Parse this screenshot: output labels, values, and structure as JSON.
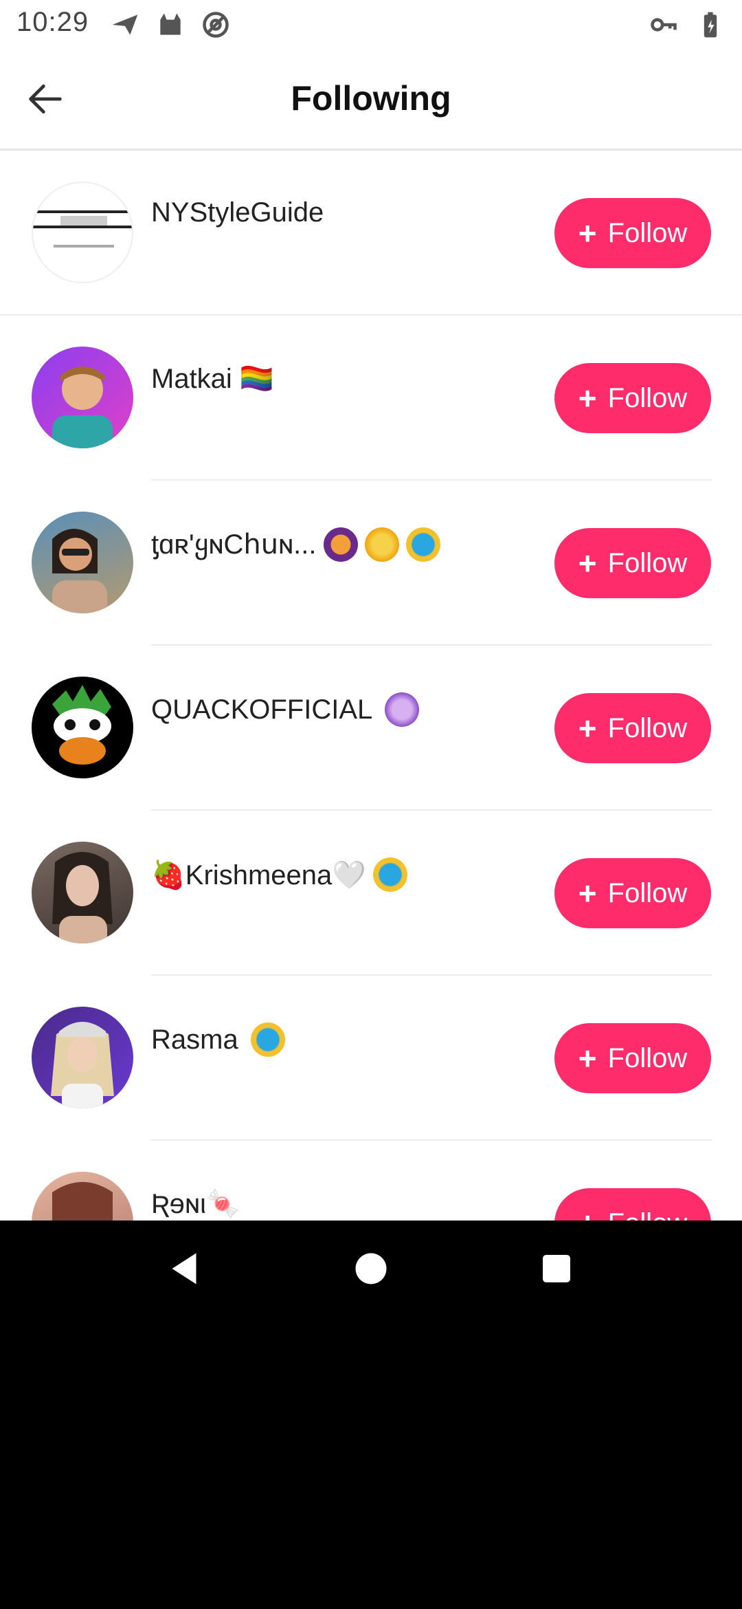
{
  "status_bar": {
    "time": "10:29",
    "left_icons": [
      "send-icon",
      "cat-icon",
      "at-sign-icon"
    ],
    "right_icons": [
      "key-icon",
      "battery-icon"
    ]
  },
  "header": {
    "title": "Following",
    "back_icon": "arrow-left-icon"
  },
  "follow_label": "Follow",
  "users": [
    {
      "name": "NYStyleGuide",
      "badges": []
    },
    {
      "name": "Matkai 🏳️‍🌈",
      "badges": []
    },
    {
      "name": "ƫɑʀ'ყɴϹհսɴ...",
      "badges": [
        "skull-badge",
        "medal-badge",
        "crown-badge"
      ]
    },
    {
      "name": "QUACKOFFICIAL",
      "badges": [
        "gem-badge"
      ]
    },
    {
      "name": "🍓Krishmeena🤍",
      "badges": [
        "crown-badge"
      ]
    },
    {
      "name": "Rasma",
      "badges": [
        "crown-badge"
      ]
    },
    {
      "name": "Ʀɘɴι🍬",
      "badges": []
    }
  ],
  "colors": {
    "accent": "#fe2c6b",
    "divider": "#ececec"
  },
  "nav_bar": [
    "back-triangle-icon",
    "home-circle-icon",
    "recents-square-icon"
  ]
}
